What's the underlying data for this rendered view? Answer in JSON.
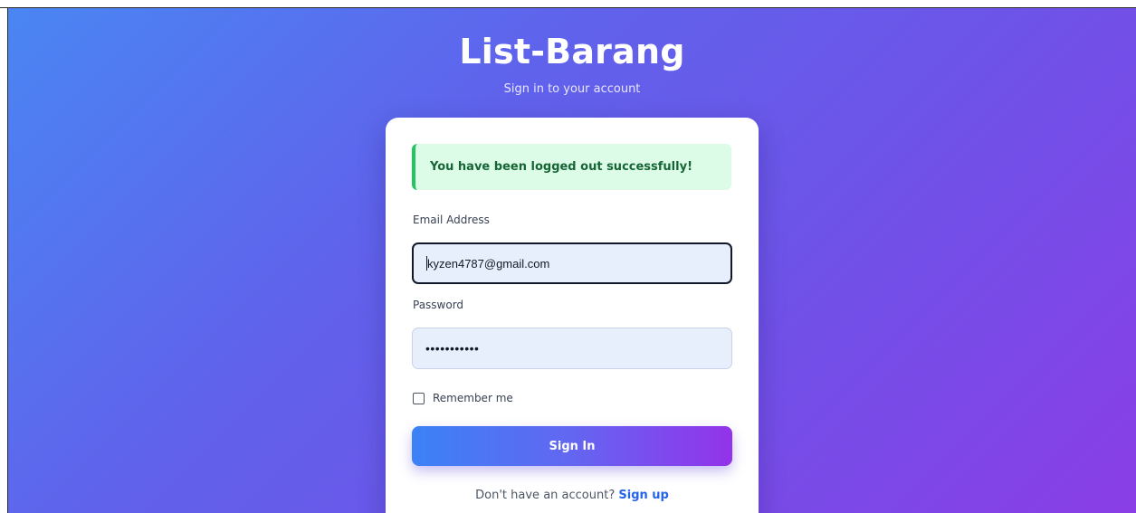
{
  "app": {
    "title": "List-Barang",
    "subtitle": "Sign in to your account"
  },
  "alert": {
    "message": "You have been logged out successfully!",
    "type": "success"
  },
  "form": {
    "email_label": "Email Address",
    "email_value": "kyzen4787@gmail.com",
    "password_label": "Password",
    "password_value": "•••••••••••",
    "remember_label": "Remember me",
    "remember_checked": false,
    "submit_label": "Sign In"
  },
  "footer": {
    "prompt": "Don't have an account?",
    "link_label": "Sign up"
  },
  "colors": {
    "gradient_start": "#4a86f3",
    "gradient_end": "#8a3ee6",
    "alert_bg": "#dcfce7",
    "alert_border": "#22c55e",
    "alert_text": "#166534",
    "link": "#2563eb"
  }
}
